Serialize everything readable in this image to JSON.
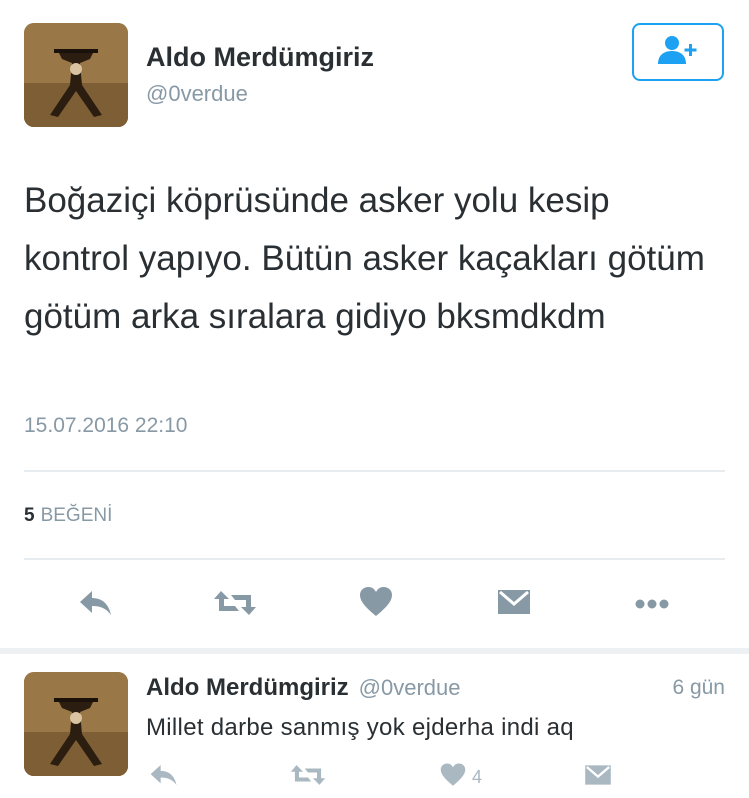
{
  "tweet": {
    "author_name": "Aldo Merdümgiriz",
    "author_handle": "@0verdue",
    "text": "Boğaziçi köprüsünde asker yolu kesip kontrol yapıyo. Bütün asker kaçakları götüm götüm arka sıralara gidiyo bksmdkdm",
    "timestamp": "15.07.2016 22:10",
    "likes_count": "5",
    "likes_label": "BEĞENİ",
    "follow_icon": "add-user-icon",
    "actions": [
      "reply-icon",
      "retweet-icon",
      "heart-icon",
      "message-icon",
      "more-icon"
    ]
  },
  "reply": {
    "author_name": "Aldo Merdümgiriz",
    "author_handle": "@0verdue",
    "time": "6 gün",
    "text": "Millet darbe sanmış yok ejderha indi aq",
    "like_count": "4",
    "actions": [
      "reply-icon",
      "retweet-icon",
      "heart-icon",
      "message-icon"
    ]
  },
  "colors": {
    "accent": "#1da1f2",
    "text": "#292f33",
    "muted": "#8899a6",
    "icon": "#8899a6",
    "divider": "#e6ecf0"
  }
}
